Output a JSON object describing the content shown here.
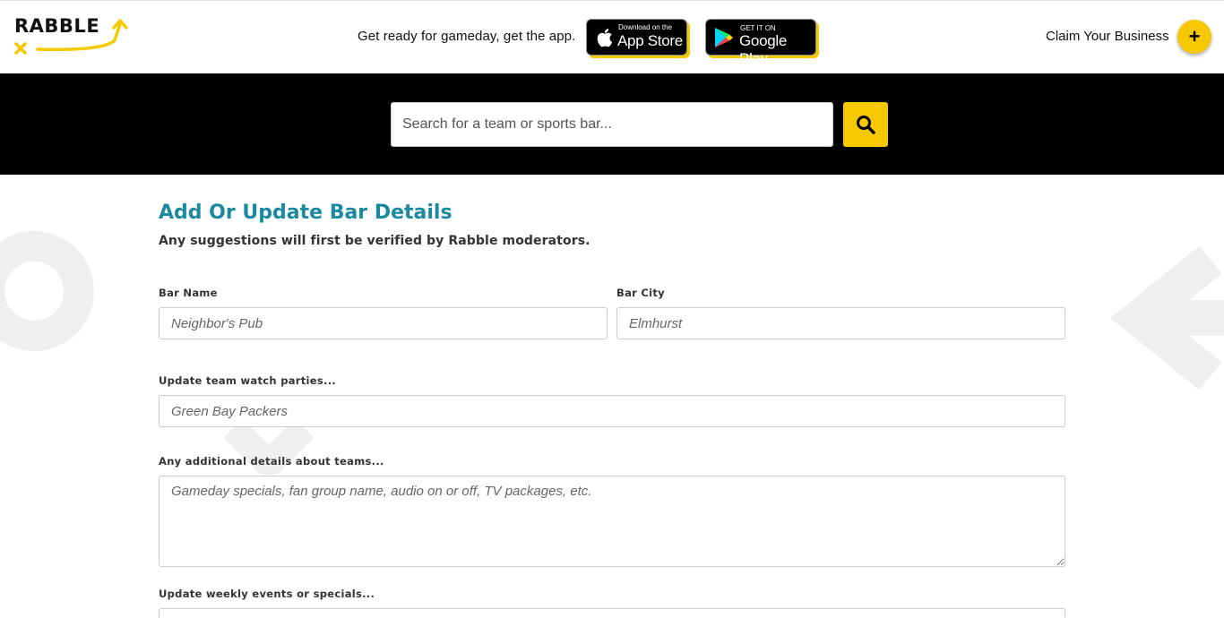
{
  "header": {
    "logo_text": "RABBLE",
    "promo_text": "Get ready for gameday, get the app.",
    "app_store": {
      "small": "Download on the",
      "big": "App Store"
    },
    "google_play": {
      "small": "GET IT ON",
      "big": "Google Play"
    },
    "claim_text": "Claim Your Business",
    "plus_symbol": "+"
  },
  "search": {
    "placeholder": "Search for a team or sports bar..."
  },
  "form": {
    "title": "Add Or Update Bar Details",
    "subtitle": "Any suggestions will first be verified by Rabble moderators.",
    "bar_name": {
      "label": "Bar Name",
      "placeholder": "Neighbor's Pub"
    },
    "bar_city": {
      "label": "Bar City",
      "placeholder": "Elmhurst"
    },
    "team": {
      "label": "Update team watch parties...",
      "placeholder": "Green Bay Packers"
    },
    "details": {
      "label": "Any additional details about teams...",
      "placeholder": "Gameday specials, fan group name, audio on or off, TV packages, etc."
    },
    "events": {
      "label": "Update weekly events or specials..."
    }
  },
  "colors": {
    "accent_yellow": "#f5c800",
    "title_teal": "#1a8aa0",
    "band_black": "#000000"
  }
}
